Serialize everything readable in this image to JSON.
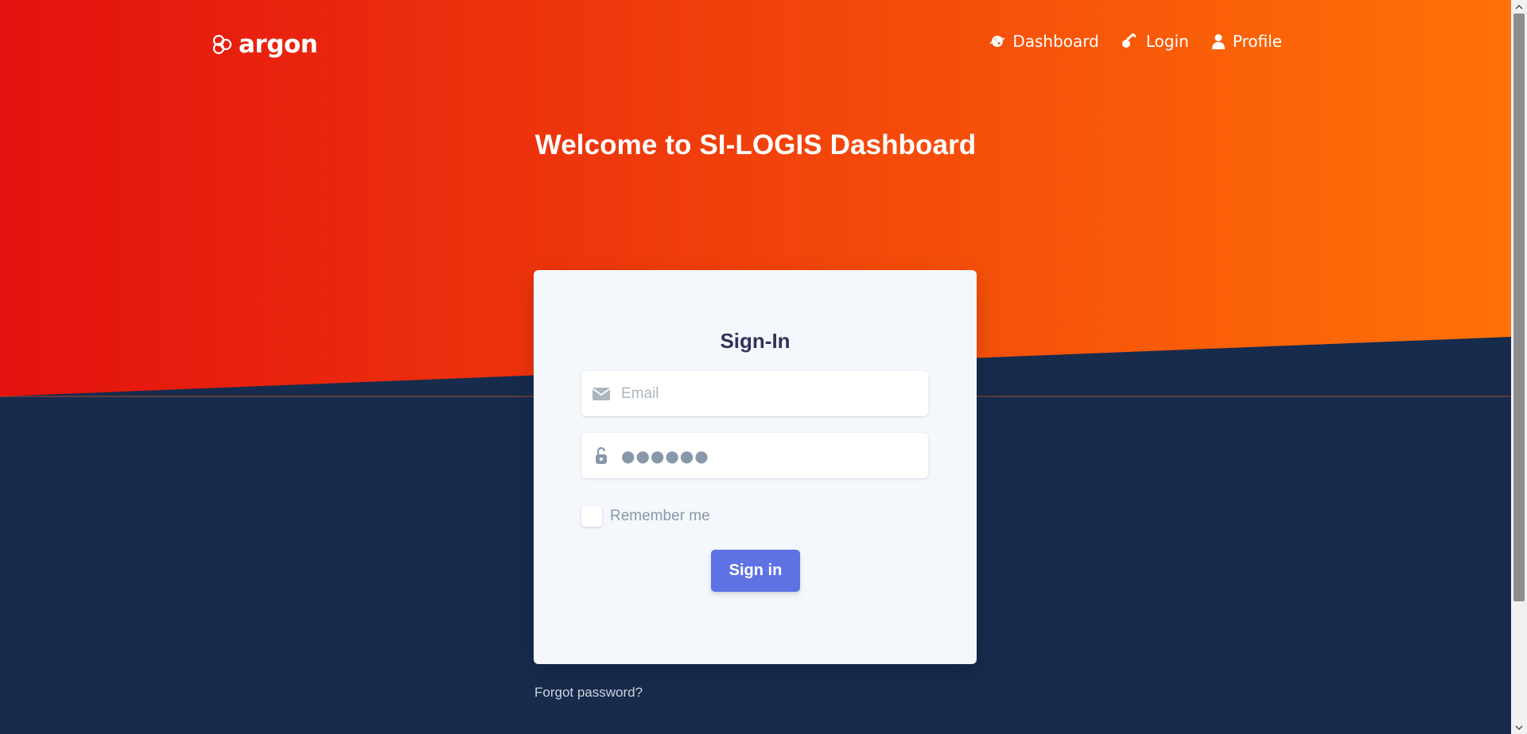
{
  "brand": {
    "name": "argon",
    "icon": "argon-logo-icon"
  },
  "nav": {
    "items": [
      {
        "label": "Dashboard",
        "icon": "planet-icon"
      },
      {
        "label": "Login",
        "icon": "key-icon"
      },
      {
        "label": "Profile",
        "icon": "user-icon"
      }
    ]
  },
  "hero": {
    "title": "Welcome to SI-LOGIS Dashboard"
  },
  "form": {
    "title": "Sign-In",
    "email_placeholder": "Email",
    "email_value": "",
    "password_value": "●●●●●●",
    "remember_label": "Remember me",
    "submit_label": "Sign in"
  },
  "footer": {
    "forgot_label": "Forgot password?"
  },
  "colors": {
    "header_gradient_start": "#e3110f",
    "header_gradient_end": "#ff7207",
    "background": "#172b4d",
    "card": "#f4f7fb",
    "primary_button": "#5e72e4",
    "muted_text": "#8898aa"
  }
}
